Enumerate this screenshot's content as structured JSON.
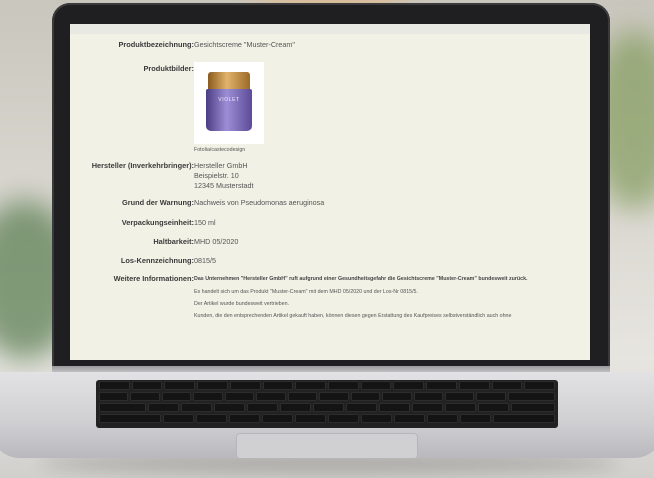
{
  "product": {
    "name_label": "Produktbezeichnung:",
    "name_value": "Gesichtscreme \"Muster-Cream\"",
    "images_label": "Produktbilder:",
    "image_brand": "VIOLET",
    "image_credit": "Fotolia/castecodesign",
    "manufacturer_label": "Hersteller (Inverkehrbringer):",
    "manufacturer_lines": [
      "Hersteller GmbH",
      "Beispielstr. 10",
      "12345 Musterstadt"
    ],
    "reason_label": "Grund der Warnung:",
    "reason_value": "Nachweis von Pseudomonas aeruginosa",
    "packaging_label": "Verpackungseinheit:",
    "packaging_value": "150 ml",
    "shelf_life_label": "Haltbarkeit:",
    "shelf_life_value": "MHD 05/2020",
    "lot_label": "Los-Kennzeichnung:",
    "lot_value": "0815/5",
    "info_label": "Weitere Informationen:",
    "info_lines": [
      "Das Unternehmen \"Hersteller GmbH\" ruft aufgrund einer Gesundheitsgefahr die Gesichtscreme \"Muster-Cream\" bundesweit zurück.",
      "Es handelt sich um das Produkt \"Muster-Cream\" mit dem MHD 05/2020 und der Los-Nr 0815/5.",
      "Der Artikel wurde bundesweit vertrieben.",
      "Kunden, die den entsprechenden Artikel gekauft haben, können diesen gegen Erstattung des Kaufpreises selbstverständlich auch ohne"
    ]
  }
}
